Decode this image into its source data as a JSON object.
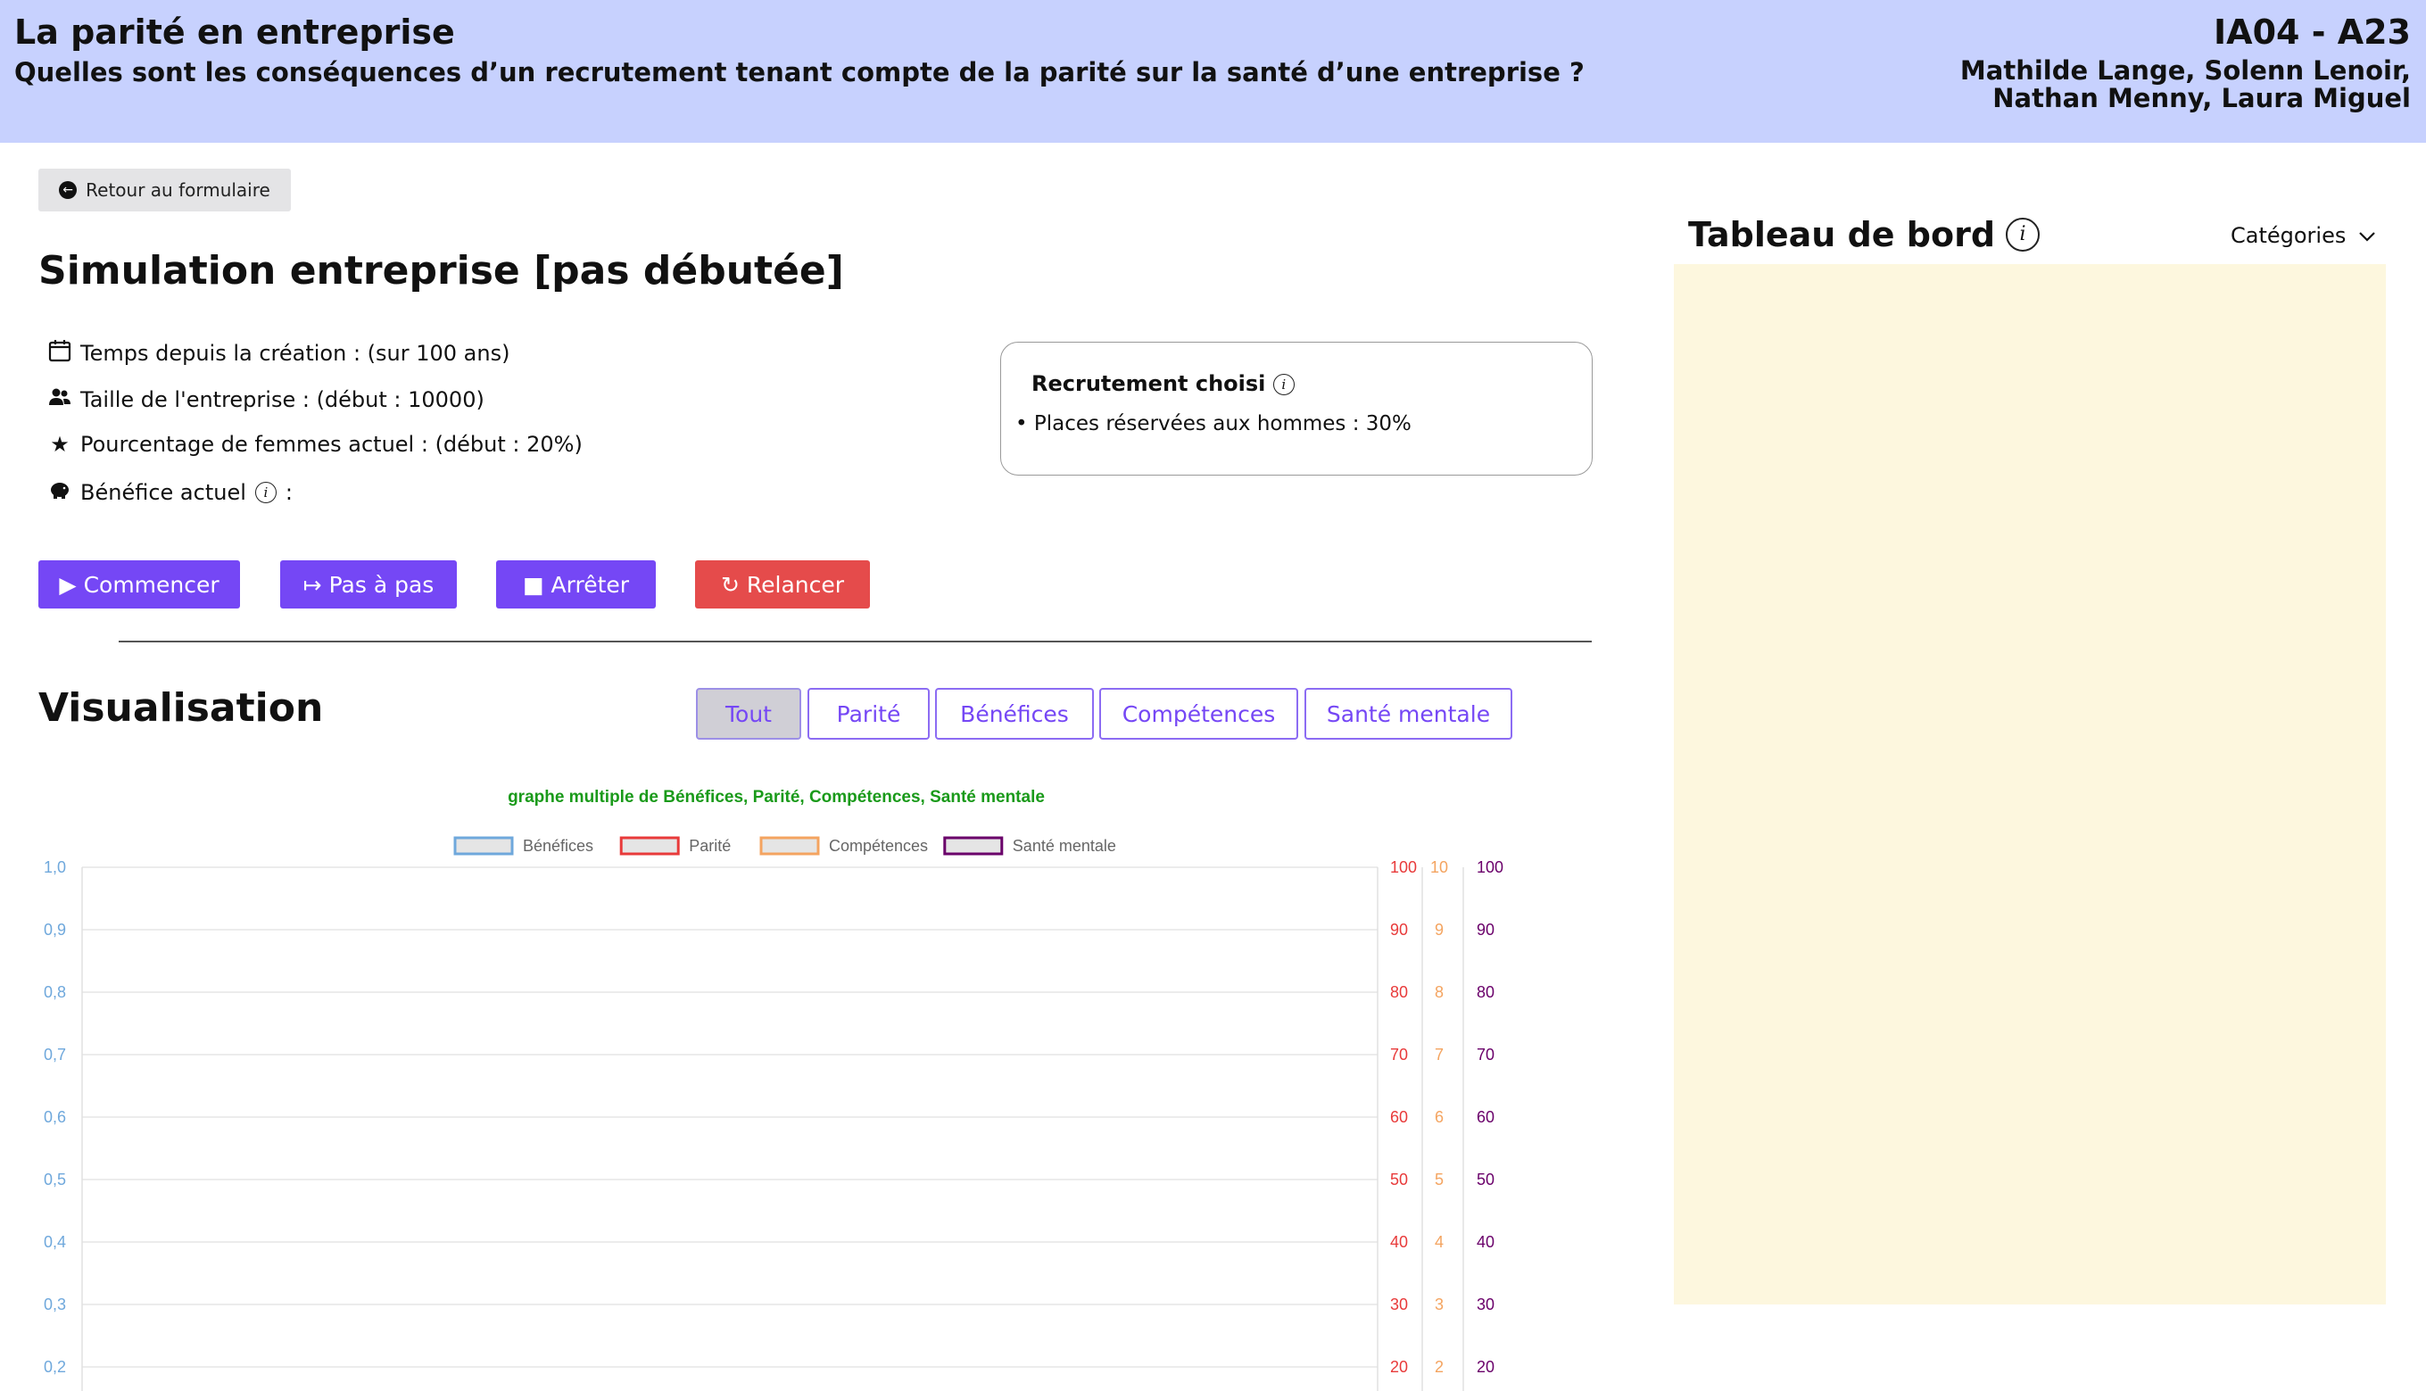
{
  "header": {
    "title": "La parité en entreprise",
    "subtitle": "Quelles sont les conséquences d’un recrutement tenant compte de la parité sur la santé d’une entreprise ?",
    "course": "IA04 - A23",
    "authors_line1": "Mathilde Lange, Solenn Lenoir,",
    "authors_line2": "Nathan Menny, Laura Miguel"
  },
  "back_button": "Retour au formulaire",
  "simulation": {
    "title": "Simulation entreprise [pas débutée]",
    "time": "Temps depuis la création : (sur 100 ans)",
    "size": "Taille de l'entreprise : (début : 10000)",
    "women": "Pourcentage de femmes actuel : (début : 20%)",
    "profit_label": "Bénéfice actuel",
    "profit_suffix": ":"
  },
  "recruitment": {
    "title": "Recrutement choisi",
    "item": "Places réservées aux hommes : 30%"
  },
  "controls": {
    "start": "Commencer",
    "step": "Pas à pas",
    "stop": "Arrêter",
    "restart": "Relancer"
  },
  "visualisation": {
    "title": "Visualisation",
    "tabs": [
      "Tout",
      "Parité",
      "Bénéfices",
      "Compétences",
      "Santé mentale"
    ],
    "active_tab": "Tout"
  },
  "chart_data": {
    "type": "line",
    "title": "graphe multiple de Bénéfices, Parité, Compétences, Santé mentale",
    "series": [
      {
        "name": "Bénéfices",
        "values": [],
        "color": "#6fa8dc",
        "fill": "#e5e5e5"
      },
      {
        "name": "Parité",
        "values": [],
        "color": "#e83a3a",
        "fill": "#e5e5e5"
      },
      {
        "name": "Compétences",
        "values": [],
        "color": "#f4a460",
        "fill": "#e5e5e5"
      },
      {
        "name": "Santé mentale",
        "values": [],
        "color": "#6a006a",
        "fill": "#e5e5e5"
      }
    ],
    "axes": [
      {
        "series": "Bénéfices",
        "side": "left",
        "ylim": [
          0,
          1
        ],
        "ticks": [
          "1,0",
          "0,9",
          "0,8",
          "0,7",
          "0,6",
          "0,5",
          "0,4",
          "0,3",
          "0,2"
        ],
        "color": "#6fa8dc"
      },
      {
        "series": "Parité",
        "side": "right",
        "ylim": [
          0,
          100
        ],
        "ticks": [
          "100",
          "90",
          "80",
          "70",
          "60",
          "50",
          "40",
          "30",
          "20"
        ],
        "color": "#e83a3a"
      },
      {
        "series": "Compétences",
        "side": "right",
        "ylim": [
          0,
          10
        ],
        "ticks": [
          "10",
          "9",
          "8",
          "7",
          "6",
          "5",
          "4",
          "3",
          "2"
        ],
        "color": "#f4a460"
      },
      {
        "series": "Santé mentale",
        "side": "right",
        "ylim": [
          0,
          100
        ],
        "ticks": [
          "100",
          "90",
          "80",
          "70",
          "60",
          "50",
          "40",
          "30",
          "20"
        ],
        "color": "#6a006a"
      }
    ],
    "grid": true,
    "legend": "top-center"
  },
  "dashboard": {
    "title": "Tableau de bord",
    "categories_label": "Catégories"
  }
}
